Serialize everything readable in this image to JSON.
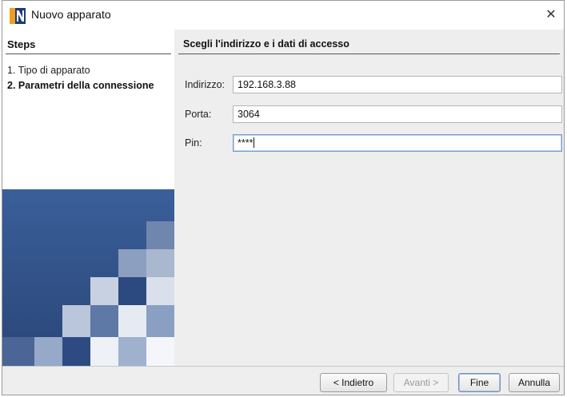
{
  "window": {
    "title": "Nuovo apparato",
    "close_label": "✕"
  },
  "steps": {
    "title": "Steps",
    "items": [
      {
        "label": "1. Tipo di apparato",
        "active": false
      },
      {
        "label": "2. Parametri della connessione",
        "active": true
      }
    ]
  },
  "form": {
    "title": "Scegli l'indirizzo e i dati di accesso",
    "fields": {
      "address": {
        "label": "Indirizzo:",
        "value": "192.168.3.88"
      },
      "port": {
        "label": "Porta:",
        "value": "3064"
      },
      "pin": {
        "label": "Pin:",
        "value": "****"
      }
    }
  },
  "buttons": {
    "back": "< Indietro",
    "next": "Avanti >",
    "finish": "Fine",
    "cancel": "Annulla"
  },
  "colors": {
    "panel_bg": "#eeeeee",
    "art_blue": "#2f4f86",
    "art_light": "#c5cfe0",
    "field_focus_border": "#7a9cc8"
  },
  "icons": {
    "app": "app-logo-icon",
    "close": "close-icon"
  }
}
